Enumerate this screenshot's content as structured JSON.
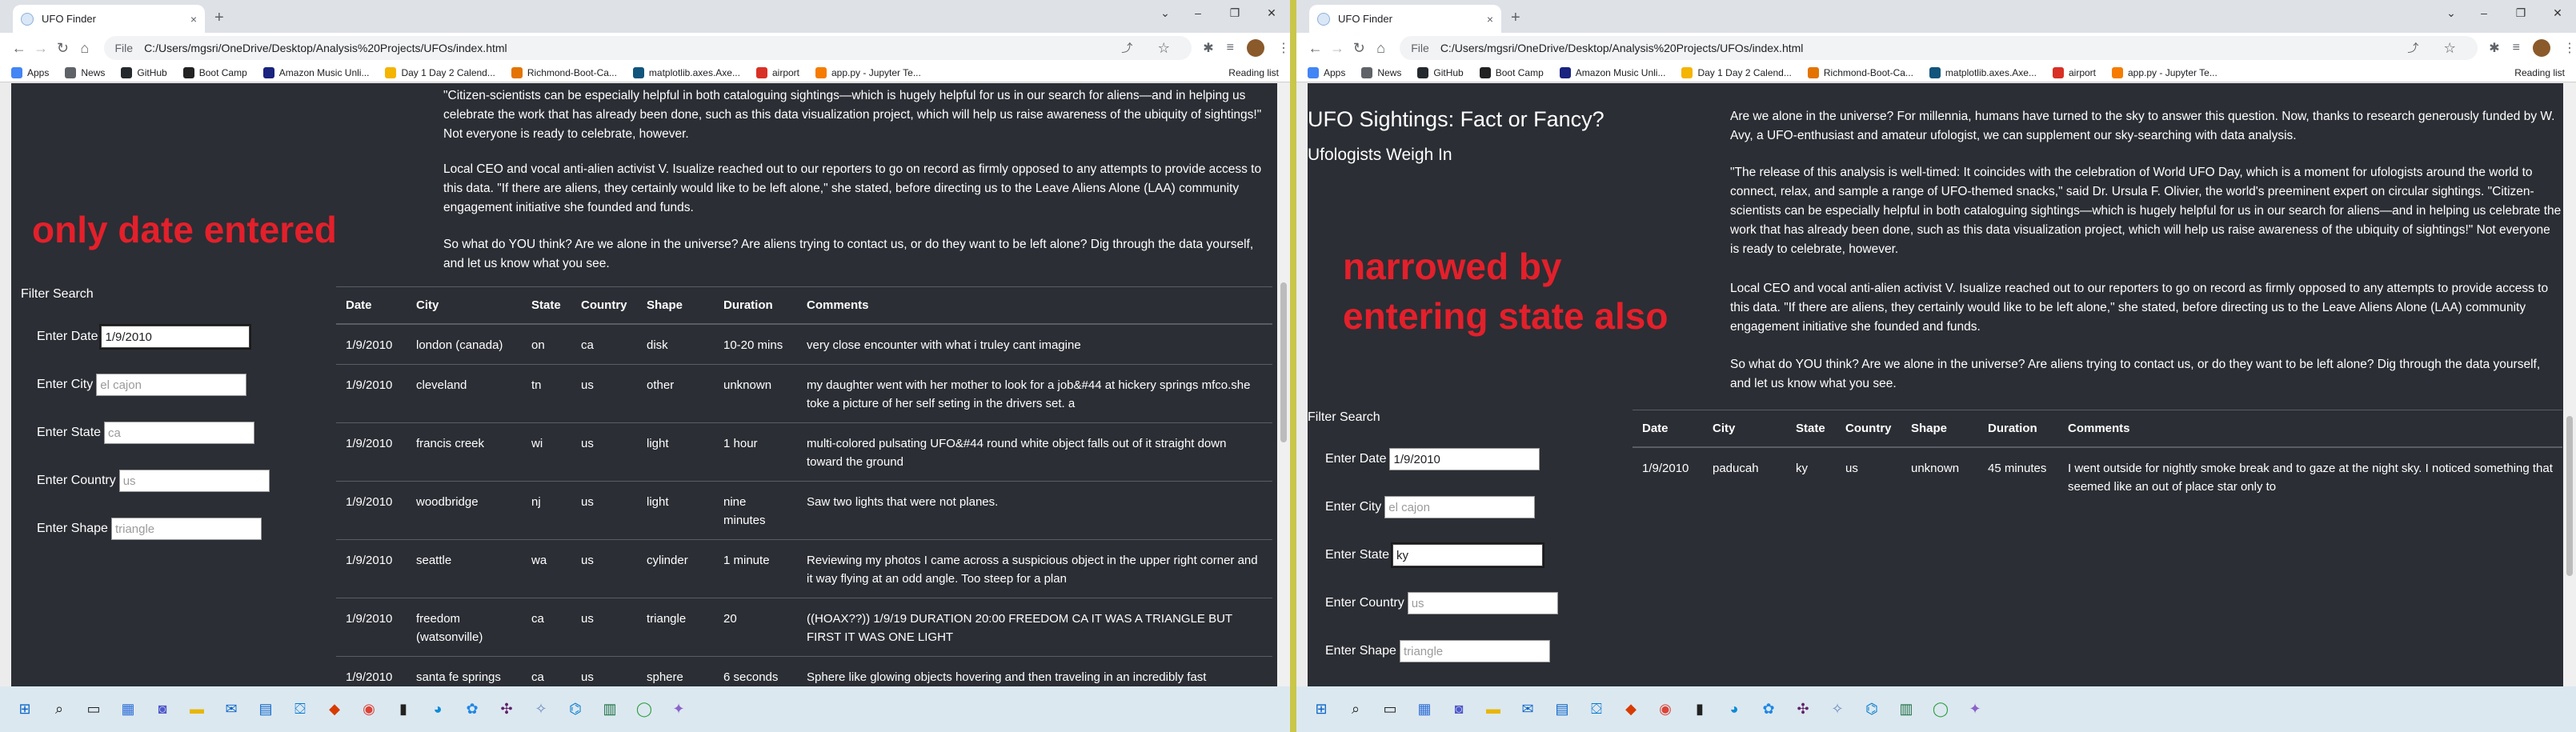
{
  "browser": {
    "tab_title": "UFO Finder",
    "tab_close": "×",
    "new_tab": "+",
    "file_label": "File",
    "url": "C:/Users/mgsri/OneDrive/Desktop/Analysis%20Projects/UFOs/index.html",
    "window_controls": [
      "⌄",
      "–",
      "❐",
      "✕"
    ],
    "nav": {
      "back": "←",
      "forward": "→",
      "reload": "↻",
      "home": "⌂"
    },
    "omni_icons": "⤴ ☆",
    "toolbar_icons": [
      "✱",
      "≡"
    ],
    "menu": "⋮",
    "bookmarks": [
      {
        "label": "Apps",
        "color": "#4285f4"
      },
      {
        "label": "News",
        "color": "#5f6368"
      },
      {
        "label": "GitHub",
        "color": "#24292e"
      },
      {
        "label": "Boot Camp",
        "color": "#222222"
      },
      {
        "label": "Amazon Music Unli...",
        "color": "#1a237e"
      },
      {
        "label": "Day 1 Day 2 Calend...",
        "color": "#f4b400"
      },
      {
        "label": "Richmond-Boot-Ca...",
        "color": "#e37400"
      },
      {
        "label": "matplotlib.axes.Axe...",
        "color": "#11557c"
      },
      {
        "label": "airport",
        "color": "#d93025"
      },
      {
        "label": "app.py - Jupyter Te...",
        "color": "#f57c00"
      }
    ],
    "reading_list": "Reading list"
  },
  "left": {
    "annotation": "only date entered",
    "paragraphs": [
      "\"Citizen-scientists can be especially helpful in both cataloguing sightings—which is hugely helpful for us in our search for aliens—and in helping us celebrate the work that has already been done, such as this data visualization project, which will help us raise awareness of the ubiquity of sightings!\" Not everyone is ready to celebrate, however.",
      "Local CEO and vocal anti-alien activist V. Isualize reached out to our reporters to go on record as firmly opposed to any attempts to provide access to this data. \"If there are aliens, they certainly would like to be left alone,\" she stated, before directing us to the Leave Aliens Alone (LAA) community engagement initiative she founded and funds.",
      "So what do YOU think? Are we alone in the universe? Are aliens trying to contact us, or do they want to be left alone? Dig through the data yourself, and let us know what you see."
    ],
    "filter": {
      "header": "Filter Search",
      "date": {
        "label": "Enter Date",
        "value": "1/9/2010",
        "placeholder": ""
      },
      "city": {
        "label": "Enter City",
        "value": "",
        "placeholder": "el cajon"
      },
      "state": {
        "label": "Enter State",
        "value": "",
        "placeholder": "ca"
      },
      "country": {
        "label": "Enter Country",
        "value": "",
        "placeholder": "us"
      },
      "shape": {
        "label": "Enter Shape",
        "value": "",
        "placeholder": "triangle"
      }
    },
    "table": {
      "headers": [
        "Date",
        "City",
        "State",
        "Country",
        "Shape",
        "Duration",
        "Comments"
      ],
      "rows": [
        [
          "1/9/2010",
          "london (canada)",
          "on",
          "ca",
          "disk",
          "10-20 mins",
          "very close encounter with what i truley cant imagine"
        ],
        [
          "1/9/2010",
          "cleveland",
          "tn",
          "us",
          "other",
          "unknown",
          "my daughter went with her mother to look for a job&#44 at hickery springs mfco.she toke a picture of her self seting in the drivers set. a"
        ],
        [
          "1/9/2010",
          "francis creek",
          "wi",
          "us",
          "light",
          "1 hour",
          "multi-colored pulsating UFO&#44 round white object falls out of it straight down toward the ground"
        ],
        [
          "1/9/2010",
          "woodbridge",
          "nj",
          "us",
          "light",
          "nine minutes",
          "Saw two lights that were not planes."
        ],
        [
          "1/9/2010",
          "seattle",
          "wa",
          "us",
          "cylinder",
          "1 minute",
          "Reviewing my photos I came across a suspicious object in the upper right corner and it way flying at an odd angle. Too steep for a plan"
        ],
        [
          "1/9/2010",
          "freedom (watsonville)",
          "ca",
          "us",
          "triangle",
          "20",
          "((HOAX??)) 1/9/19 DURATION 20:00 FREEDOM CA IT WAS A TRIANGLE BUT FIRST IT WAS ONE LIGHT"
        ],
        [
          "1/9/2010",
          "santa fe springs",
          "ca",
          "us",
          "sphere",
          "6 seconds",
          "Sphere like glowing objects hovering and then traveling in an incredibly fast"
        ]
      ]
    },
    "scroll_fraction": 0.45
  },
  "right": {
    "annotation": "narrowed by entering state also",
    "title": "UFO Sightings: Fact or Fancy?",
    "subtitle": "Ufologists Weigh In",
    "paragraphs": [
      "Are we alone in the universe? For millennia, humans have turned to the sky to answer this question. Now, thanks to research generously funded by W. Avy, a UFO-enthusiast and amateur ufologist, we can supplement our sky-searching with data analysis.",
      "\"The release of this analysis is well-timed: It coincides with the celebration of World UFO Day, which is a moment for ufologists around the world to connect, relax, and sample a range of UFO-themed snacks,\" said Dr. Ursula F. Olivier, the world's preeminent expert on circular sightings. \"Citizen-scientists can be especially helpful in both cataloguing sightings—which is hugely helpful for us in our search for aliens—and in helping us celebrate the work that has already been done, such as this data visualization project, which will help us raise awareness of the ubiquity of sightings!\" Not everyone is ready to celebrate, however.",
      "Local CEO and vocal anti-alien activist V. Isualize reached out to our reporters to go on record as firmly opposed to any attempts to provide access to this data. \"If there are aliens, they certainly would like to be left alone,\" she stated, before directing us to the Leave Aliens Alone (LAA) community engagement initiative she founded and funds.",
      "So what do YOU think? Are we alone in the universe? Are aliens trying to contact us, or do they want to be left alone? Dig through the data yourself, and let us know what you see."
    ],
    "filter": {
      "header": "Filter Search",
      "date": {
        "label": "Enter Date",
        "value": "1/9/2010",
        "placeholder": ""
      },
      "city": {
        "label": "Enter City",
        "value": "",
        "placeholder": "el cajon"
      },
      "state": {
        "label": "Enter State",
        "value": "ky",
        "placeholder": ""
      },
      "country": {
        "label": "Enter Country",
        "value": "",
        "placeholder": "us"
      },
      "shape": {
        "label": "Enter Shape",
        "value": "",
        "placeholder": "triangle"
      }
    },
    "table": {
      "headers": [
        "Date",
        "City",
        "State",
        "Country",
        "Shape",
        "Duration",
        "Comments"
      ],
      "rows": [
        [
          "1/9/2010",
          "paducah",
          "ky",
          "us",
          "unknown",
          "45 minutes",
          "I went outside for nightly smoke break and to gaze at the night sky. I noticed something that seemed like an out of place star only to"
        ]
      ]
    },
    "scroll_fraction": 0.75
  },
  "taskbar": {
    "icons": [
      {
        "name": "windows-start-icon",
        "glyph": "⊞",
        "color": "#0a64c8"
      },
      {
        "name": "search-icon",
        "glyph": "⌕",
        "color": "#222222"
      },
      {
        "name": "task-view-icon",
        "glyph": "▭",
        "color": "#222222"
      },
      {
        "name": "widgets-icon",
        "glyph": "▦",
        "color": "#2f6fd6"
      },
      {
        "name": "teams-icon",
        "glyph": "◙",
        "color": "#5059c9"
      },
      {
        "name": "file-explorer-icon",
        "glyph": "▬",
        "color": "#e8b600"
      },
      {
        "name": "mail-icon",
        "glyph": "✉",
        "color": "#0a64c8"
      },
      {
        "name": "calendar-icon",
        "glyph": "▤",
        "color": "#0a64c8"
      },
      {
        "name": "store-icon",
        "glyph": "⛋",
        "color": "#0078d4"
      },
      {
        "name": "office-icon",
        "glyph": "◆",
        "color": "#d83b01"
      },
      {
        "name": "chrome-icon",
        "glyph": "◉",
        "color": "#db4437"
      },
      {
        "name": "terminal-icon",
        "glyph": "▮",
        "color": "#222222"
      },
      {
        "name": "edge-icon",
        "glyph": "◕",
        "color": "#0c8bd6"
      },
      {
        "name": "photos-icon",
        "glyph": "✿",
        "color": "#1e88e5"
      },
      {
        "name": "slack-icon",
        "glyph": "✣",
        "color": "#611f69"
      },
      {
        "name": "app-icon",
        "glyph": "✧",
        "color": "#6c8ebf"
      },
      {
        "name": "vscode-icon",
        "glyph": "⌬",
        "color": "#007acc"
      },
      {
        "name": "excel-icon",
        "glyph": "▥",
        "color": "#1d6f42"
      },
      {
        "name": "green-circle-icon",
        "glyph": "◯",
        "color": "#2ea043"
      },
      {
        "name": "misc-app-icon",
        "glyph": "✦",
        "color": "#8a64c8"
      }
    ]
  }
}
